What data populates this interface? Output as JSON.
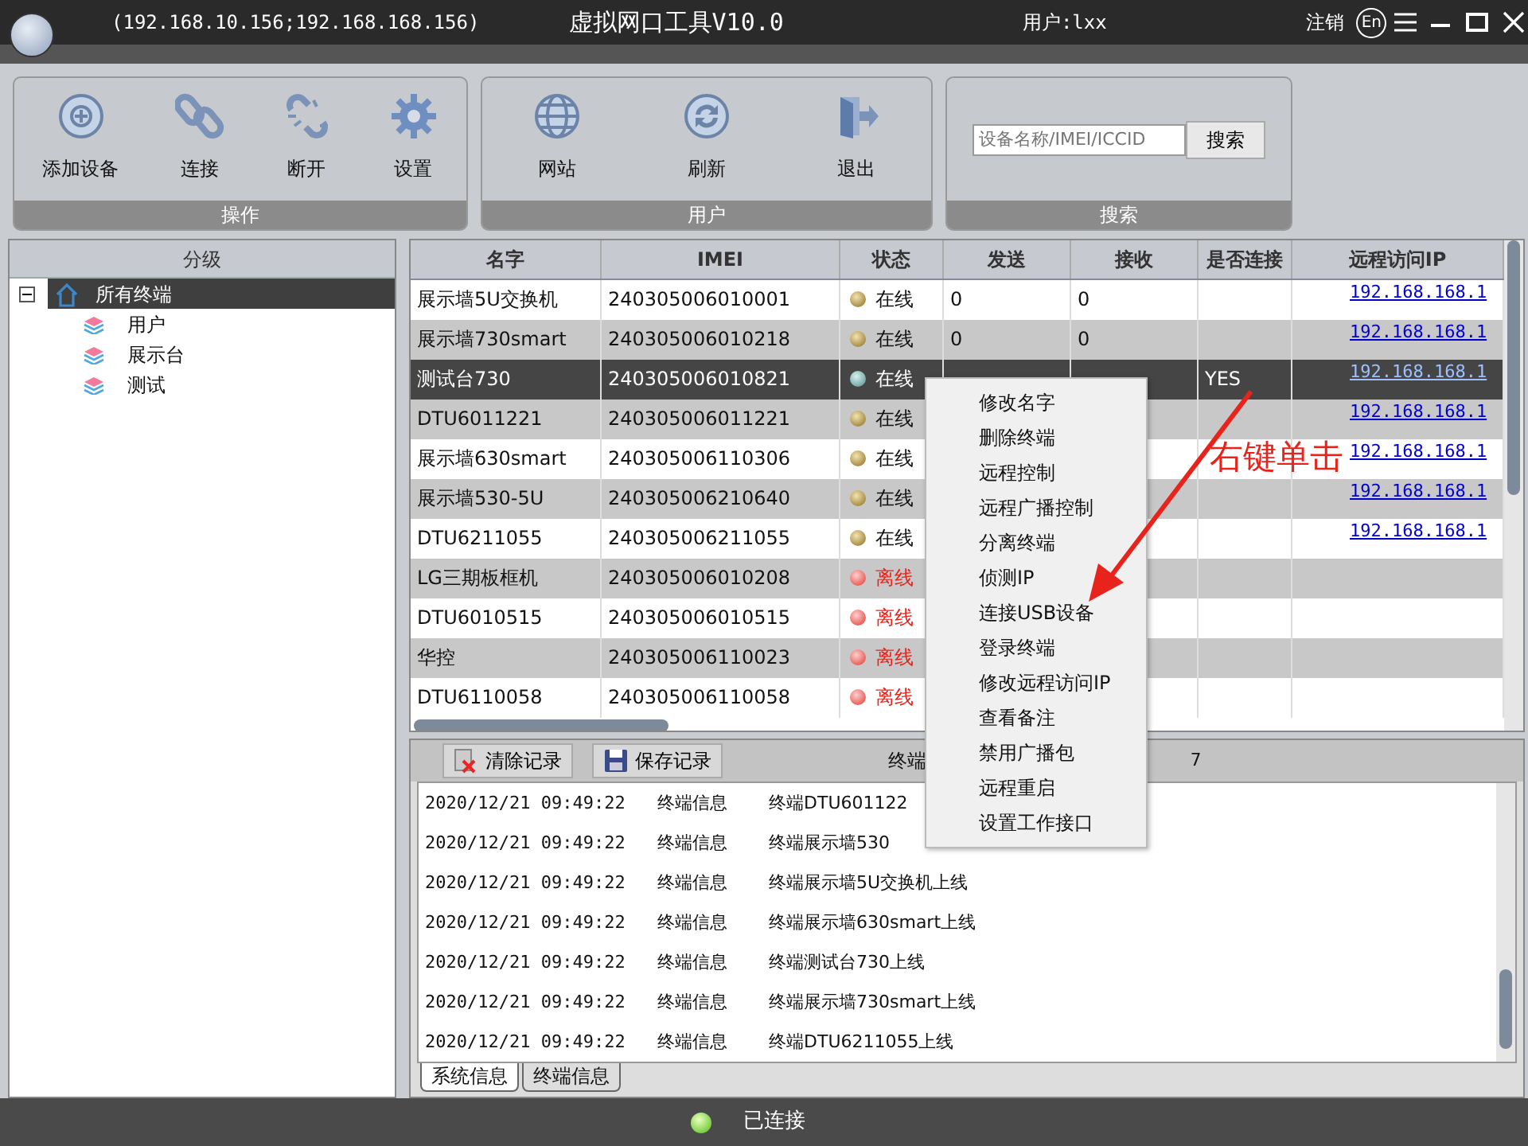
{
  "window": {
    "address": "(192.168.10.156;192.168.168.156)",
    "title": "虚拟网口工具V10.0",
    "user": "用户:lxx",
    "logout": "注销",
    "language": "En"
  },
  "toolbar": {
    "groups": [
      {
        "label": "操作",
        "buttons": [
          "添加设备",
          "连接",
          "断开",
          "设置"
        ]
      },
      {
        "label": "用户",
        "buttons": [
          "网站",
          "刷新",
          "退出"
        ]
      }
    ],
    "search": {
      "label": "搜索",
      "placeholder": "设备名称/IMEI/ICCID",
      "button": "搜索"
    }
  },
  "tree": {
    "header": "分级",
    "items": [
      {
        "label": "所有终端",
        "selected": true,
        "expanded": true,
        "children": [
          {
            "label": "用户",
            "selected": false
          },
          {
            "label": "展示台",
            "selected": false
          },
          {
            "label": "测试",
            "selected": false
          }
        ]
      }
    ]
  },
  "table": {
    "columns": [
      "名字",
      "IMEI",
      "状态",
      "发送",
      "接收",
      "是否连接",
      "远程访问IP"
    ],
    "rows": [
      {
        "name": "展示墙5U交换机",
        "imei": "240305006010001",
        "status": "在线",
        "online": true,
        "sent": "0",
        "received": "0",
        "remote_ip": "192.168.168.1",
        "selected": false
      },
      {
        "name": "展示墙730smart",
        "imei": "240305006010218",
        "status": "在线",
        "online": true,
        "sent": "0",
        "received": "0",
        "remote_ip": "192.168.168.1",
        "selected": false
      },
      {
        "name": "测试台730",
        "imei": "240305006010821",
        "status": "在线",
        "online": true,
        "connected": "YES",
        "remote_ip": "192.168.168.1",
        "selected": true
      },
      {
        "name": "DTU6011221",
        "imei": "240305006011221",
        "status": "在线",
        "online": true,
        "remote_ip": "192.168.168.1",
        "selected": false
      },
      {
        "name": "展示墙630smart",
        "imei": "240305006110306",
        "status": "在线",
        "online": true,
        "remote_ip": "192.168.168.1",
        "selected": false
      },
      {
        "name": "展示墙530-5U",
        "imei": "240305006210640",
        "status": "在线",
        "online": true,
        "remote_ip": "192.168.168.1",
        "selected": false
      },
      {
        "name": "DTU6211055",
        "imei": "240305006211055",
        "status": "在线",
        "online": true,
        "remote_ip": "192.168.168.1",
        "selected": false
      },
      {
        "name": "LG三期板框机",
        "imei": "240305006010208",
        "status": "离线",
        "online": false,
        "selected": false
      },
      {
        "name": "DTU6010515",
        "imei": "240305006010515",
        "status": "离线",
        "online": false,
        "selected": false
      },
      {
        "name": "华控",
        "imei": "240305006110023",
        "status": "离线",
        "online": false,
        "selected": false
      },
      {
        "name": "DTU6110058",
        "imei": "240305006110058",
        "status": "离线",
        "online": false,
        "selected": false
      }
    ]
  },
  "log": {
    "buttons": [
      "清除记录",
      "保存记录"
    ],
    "summary": [
      "终端",
      "7"
    ],
    "entries": [
      {
        "time": "2020/12/21 09:49:22",
        "type": "终端信息",
        "message": "终端DTU601122"
      },
      {
        "time": "2020/12/21 09:49:22",
        "type": "终端信息",
        "message": "终端展示墙530"
      },
      {
        "time": "2020/12/21 09:49:22",
        "type": "终端信息",
        "message": "终端展示墙5U交换机上线"
      },
      {
        "time": "2020/12/21 09:49:22",
        "type": "终端信息",
        "message": "终端展示墙630smart上线"
      },
      {
        "time": "2020/12/21 09:49:22",
        "type": "终端信息",
        "message": "终端测试台730上线"
      },
      {
        "time": "2020/12/21 09:49:22",
        "type": "终端信息",
        "message": "终端展示墙730smart上线"
      },
      {
        "time": "2020/12/21 09:49:22",
        "type": "终端信息",
        "message": "终端DTU6211055上线"
      }
    ],
    "tabs": [
      {
        "label": "系统信息",
        "selected": true
      },
      {
        "label": "终端信息",
        "selected": false
      }
    ]
  },
  "context_menu": {
    "items": [
      "修改名字",
      "删除终端",
      "远程控制",
      "远程广播控制",
      "分离终端",
      "侦测IP",
      "连接USB设备",
      "登录终端",
      "修改远程访问IP",
      "查看备注",
      "禁用广播包",
      "远程重启",
      "设置工作接口"
    ]
  },
  "annotation": {
    "text": "右键单击"
  },
  "status_bar": {
    "connected": true,
    "text": "已连接"
  }
}
